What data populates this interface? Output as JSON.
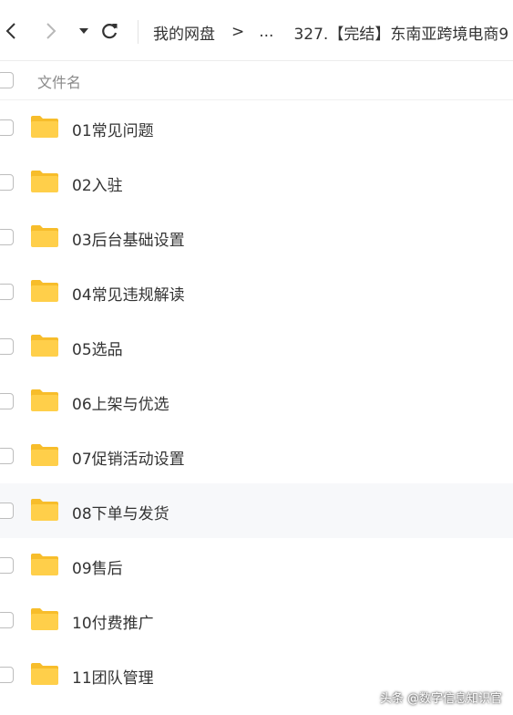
{
  "navbar": {
    "back_icon": "chevron-left-icon",
    "forward_icon": "chevron-right-icon",
    "dropdown_icon": "caret-down-icon",
    "refresh_icon": "refresh-icon",
    "breadcrumb": {
      "root": "我的网盘",
      "separator": ">",
      "ellipsis": "...",
      "current": "327.【完结】东南亚跨境电商9"
    }
  },
  "header": {
    "column_name": "文件名"
  },
  "files": [
    {
      "name": "01常见问题"
    },
    {
      "name": "02入驻"
    },
    {
      "name": "03后台基础设置"
    },
    {
      "name": "04常见违规解读"
    },
    {
      "name": "05选品"
    },
    {
      "name": "06上架与优选"
    },
    {
      "name": "07促销活动设置"
    },
    {
      "name": "08下单与发货"
    },
    {
      "name": "09售后"
    },
    {
      "name": "10付费推广"
    },
    {
      "name": "11团队管理"
    }
  ],
  "highlighted_row": 7,
  "watermark": "头条 @数字信息知识官",
  "colors": {
    "folder": "#FFCF4A",
    "folder_tab": "#F7BD2B",
    "text": "#333333",
    "muted": "#8a8a8a",
    "row_hover": "#f7f8fa"
  }
}
